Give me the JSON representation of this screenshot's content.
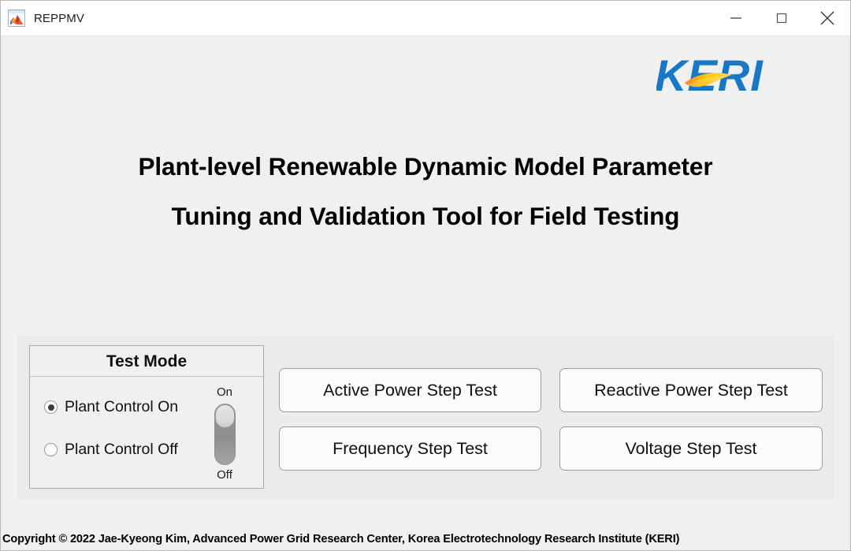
{
  "window": {
    "title": "REPPMV",
    "icon": "matlab-membrane-icon",
    "controls": {
      "minimize": "minimize-icon",
      "maximize": "maximize-icon",
      "close": "close-icon"
    }
  },
  "logo": {
    "text": "KERI",
    "blue": "#1878c8",
    "accent_orange": "#f0920a",
    "accent_yellow": "#ffd100"
  },
  "heading": {
    "line1": "Plant-level Renewable Dynamic Model Parameter",
    "line2": "Tuning and Validation Tool for Field Testing"
  },
  "test_mode": {
    "group_title": "Test Mode",
    "options": [
      {
        "label": "Plant Control On",
        "selected": true
      },
      {
        "label": "Plant Control Off",
        "selected": false
      }
    ],
    "toggle": {
      "on_label": "On",
      "off_label": "Off",
      "state": "On"
    }
  },
  "tests": {
    "buttons": [
      {
        "label": "Active Power Step Test"
      },
      {
        "label": "Reactive Power Step Test"
      },
      {
        "label": "Frequency Step Test"
      },
      {
        "label": "Voltage Step Test"
      }
    ]
  },
  "footer": {
    "copyright": "Copyright © 2022 Jae-Kyeong Kim, Advanced Power Grid Research Center, Korea Electrotechnology Research Institute (KERI)"
  }
}
